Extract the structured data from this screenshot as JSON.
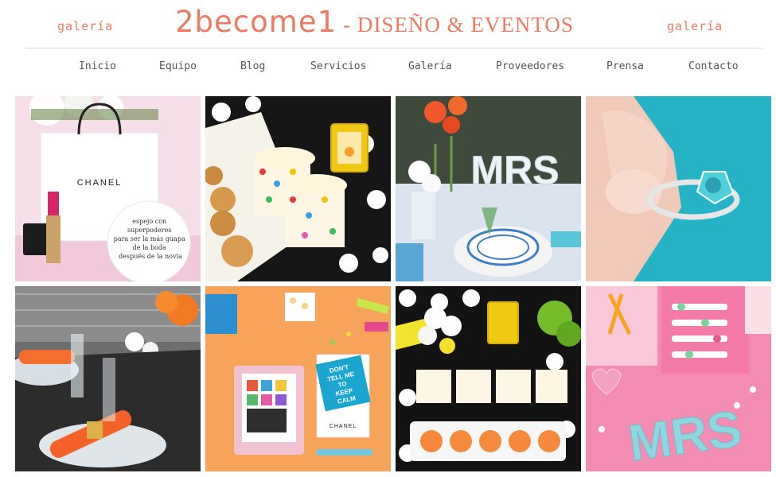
{
  "header": {
    "left_label": "galería",
    "right_label": "galería",
    "brand_name": "2become1",
    "brand_tagline": "- DISEÑO & EVENTOS"
  },
  "nav": {
    "items": [
      "Inicio",
      "Equipo",
      "Blog",
      "Servicios",
      "Galería",
      "Proveedores",
      "Prensa",
      "Contacto"
    ]
  },
  "gallery": {
    "tile1": {
      "bag_brand": "CHANEL",
      "mirror_text": [
        "espejo con",
        "superpoderes",
        "para ser la más guapa",
        "de la boda",
        "después de la novia"
      ]
    },
    "tile3": {
      "letters": "MRS"
    },
    "tile6": {
      "poster_lines": [
        "DON'T",
        "TELL ME",
        "TO",
        "KEEP",
        "CALM"
      ],
      "box_brand": "CHANEL"
    },
    "tile8": {
      "letters": "MRS"
    }
  },
  "colors": {
    "accent": "#ee7a62",
    "nav_text": "#555555",
    "divider": "#dcdcdc"
  }
}
